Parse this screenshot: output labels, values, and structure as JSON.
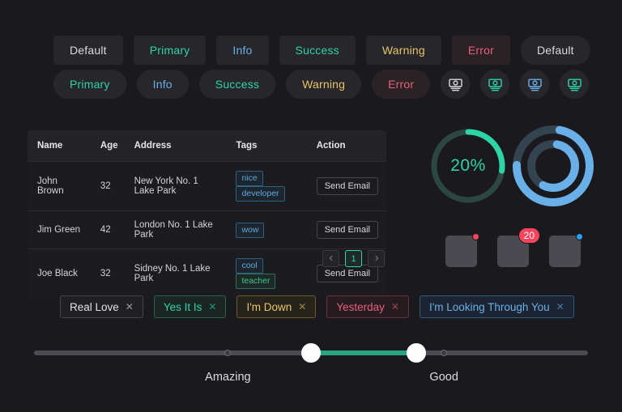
{
  "theme": {
    "background": "#1a1a1e",
    "primary": "#2dd4a7",
    "info": "#6ab0e8",
    "warning": "#e8c46a",
    "error": "#e8607a",
    "badge_red": "#f5455c",
    "badge_blue": "#2a9df4"
  },
  "buttons": {
    "square_row": [
      {
        "label": "Default",
        "variant": "default"
      },
      {
        "label": "Primary",
        "variant": "primary"
      },
      {
        "label": "Info",
        "variant": "info"
      },
      {
        "label": "Success",
        "variant": "success"
      },
      {
        "label": "Warning",
        "variant": "warning"
      },
      {
        "label": "Error",
        "variant": "error"
      },
      {
        "label": "Default",
        "variant": "default"
      }
    ],
    "round_row": [
      {
        "label": "Primary",
        "variant": "primary"
      },
      {
        "label": "Info",
        "variant": "info"
      },
      {
        "label": "Success",
        "variant": "success"
      },
      {
        "label": "Warning",
        "variant": "warning"
      },
      {
        "label": "Error",
        "variant": "error"
      }
    ],
    "icon_row": [
      {
        "icon": "money-icon",
        "color": "#d9d9de"
      },
      {
        "icon": "money-icon",
        "color": "#2dd4a7"
      },
      {
        "icon": "money-icon",
        "color": "#6ab0e8"
      },
      {
        "icon": "money-icon",
        "color": "#2dd4a7"
      }
    ]
  },
  "table": {
    "columns": [
      "Name",
      "Age",
      "Address",
      "Tags",
      "Action"
    ],
    "rows": [
      {
        "name": "John Brown",
        "age": "32",
        "address": "New York No. 1 Lake Park",
        "tags": [
          {
            "label": "nice",
            "color": "blue"
          },
          {
            "label": "developer",
            "color": "blue"
          }
        ],
        "action": "Send Email"
      },
      {
        "name": "Jim Green",
        "age": "42",
        "address": "London No. 1 Lake Park",
        "tags": [
          {
            "label": "wow",
            "color": "blue"
          }
        ],
        "action": "Send Email"
      },
      {
        "name": "Joe Black",
        "age": "32",
        "address": "Sidney No. 1 Lake Park",
        "tags": [
          {
            "label": "cool",
            "color": "blue"
          },
          {
            "label": "teacher",
            "color": "teal"
          }
        ],
        "action": "Send Email"
      }
    ]
  },
  "pagination": {
    "prev_icon": "chevron-left-icon",
    "next_icon": "chevron-right-icon",
    "current_page": "1"
  },
  "progress": {
    "teal_circle": {
      "label": "20%",
      "percent": 20,
      "color": "#2dd4a7",
      "track": "#2c4740"
    },
    "blue_dashboard": {
      "outer_percent": 72,
      "inner_percent": 55,
      "color": "#6ab0e8",
      "track": "#33434f"
    }
  },
  "badges": [
    {
      "type": "dot",
      "color": "red",
      "value": ""
    },
    {
      "type": "count",
      "color": "red",
      "value": "20"
    },
    {
      "type": "dot",
      "color": "blue",
      "value": ""
    }
  ],
  "closable_tags": [
    {
      "label": "Real Love",
      "variant": "default",
      "close_icon": "close-icon"
    },
    {
      "label": "Yes It Is",
      "variant": "green",
      "close_icon": "close-icon"
    },
    {
      "label": "I'm Down",
      "variant": "yellow",
      "close_icon": "close-icon"
    },
    {
      "label": "Yesterday",
      "variant": "red",
      "close_icon": "close-icon"
    },
    {
      "label": "I'm Looking Through You",
      "variant": "blue",
      "close_icon": "close-icon"
    }
  ],
  "slider": {
    "min": 0,
    "max": 100,
    "handle_low": 50,
    "handle_high": 69,
    "fill_color": "#2aa383",
    "marks": [
      {
        "label": "Amazing",
        "value": 35
      },
      {
        "label": "Good",
        "value": 74
      }
    ]
  }
}
